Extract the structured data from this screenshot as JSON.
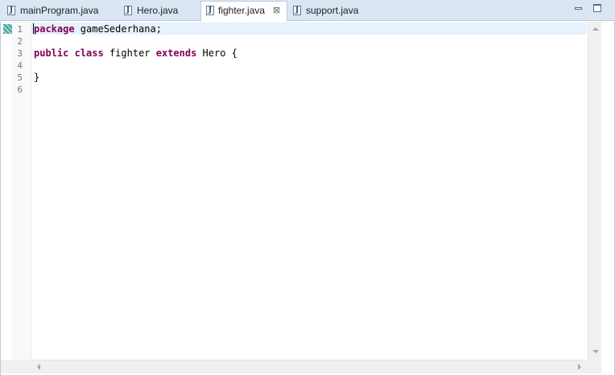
{
  "tabs": [
    {
      "label": "mainProgram.java",
      "icon": "java-file-icon",
      "active": false
    },
    {
      "label": "Hero.java",
      "icon": "java-file-icon",
      "active": false
    },
    {
      "label": "fighter.java",
      "icon": "java-file-icon",
      "active": true,
      "close_glyph": "⊠"
    },
    {
      "label": "support.java",
      "icon": "java-file-icon",
      "active": false
    }
  ],
  "file_icon_glyph": "J",
  "window_controls": {
    "minimize": "minimize-icon",
    "maximize": "maximize-icon"
  },
  "editor": {
    "line_numbers": [
      "1",
      "2",
      "3",
      "4",
      "5",
      "6"
    ],
    "lines": [
      {
        "tokens": [
          {
            "text": "package",
            "kw": true
          },
          {
            "text": " gameSederhana;",
            "kw": false
          }
        ]
      },
      {
        "tokens": []
      },
      {
        "tokens": [
          {
            "text": "public",
            "kw": true
          },
          {
            "text": " ",
            "kw": false
          },
          {
            "text": "class",
            "kw": true
          },
          {
            "text": " fighter ",
            "kw": false
          },
          {
            "text": "extends",
            "kw": true
          },
          {
            "text": " Hero {",
            "kw": false
          }
        ]
      },
      {
        "tokens": []
      },
      {
        "tokens": [
          {
            "text": "}",
            "kw": false
          }
        ]
      },
      {
        "tokens": []
      }
    ],
    "colors": {
      "keyword": "#7f0055",
      "current_line": "#e8f2fe",
      "tab_bar": "#dae6f3"
    }
  }
}
